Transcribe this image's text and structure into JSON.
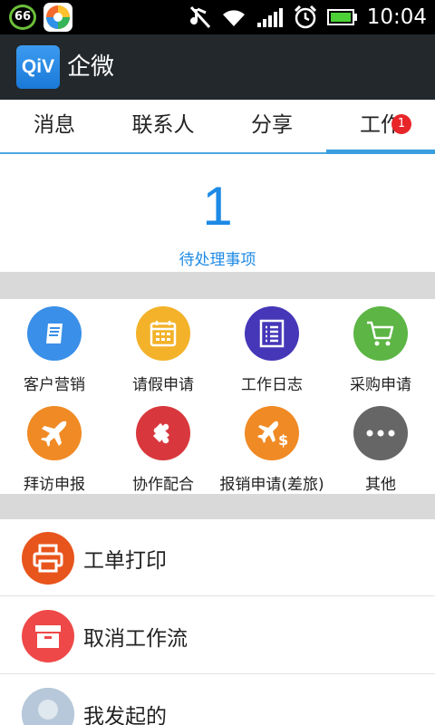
{
  "status_bar": {
    "badge": "66",
    "time": "10:04",
    "icons": [
      "mute-icon",
      "wifi-icon",
      "signal-icon",
      "alarm-icon",
      "battery-icon"
    ]
  },
  "app_bar": {
    "logo": "QiV",
    "title": "企微"
  },
  "tabs": [
    {
      "label": "消息"
    },
    {
      "label": "联系人"
    },
    {
      "label": "分享"
    },
    {
      "label": "工作",
      "badge": "1",
      "active": true
    }
  ],
  "pending": {
    "count": "1",
    "label": "待处理事项"
  },
  "grid": [
    {
      "label": "客户营销",
      "icon": "book-icon",
      "color": "#3a8fe8"
    },
    {
      "label": "请假申请",
      "icon": "calendar-icon",
      "color": "#f3b229"
    },
    {
      "label": "工作日志",
      "icon": "list-icon",
      "color": "#4537b8"
    },
    {
      "label": "采购申请",
      "icon": "cart-icon",
      "color": "#5cb544"
    },
    {
      "label": "拜访申报",
      "icon": "plane-icon",
      "color": "#f08a24"
    },
    {
      "label": "协作配合",
      "icon": "puzzle-icon",
      "color": "#d8383d"
    },
    {
      "label": "报销申请(差旅)",
      "icon": "plane-money-icon",
      "color": "#f08a24"
    },
    {
      "label": "其他",
      "icon": "more-icon",
      "color": "#666666"
    }
  ],
  "list": [
    {
      "label": "工单打印",
      "icon": "printer-icon",
      "color": "#e8551c"
    },
    {
      "label": "取消工作流",
      "icon": "archive-icon",
      "color": "#ef4848"
    },
    {
      "label": "我发起的",
      "icon": "avatar-icon",
      "color": "#9ab0c8"
    }
  ],
  "colors": {
    "accent": "#1d8ae6",
    "tab_indicator": "#3a9ee0",
    "app_bar": "#23282c"
  }
}
